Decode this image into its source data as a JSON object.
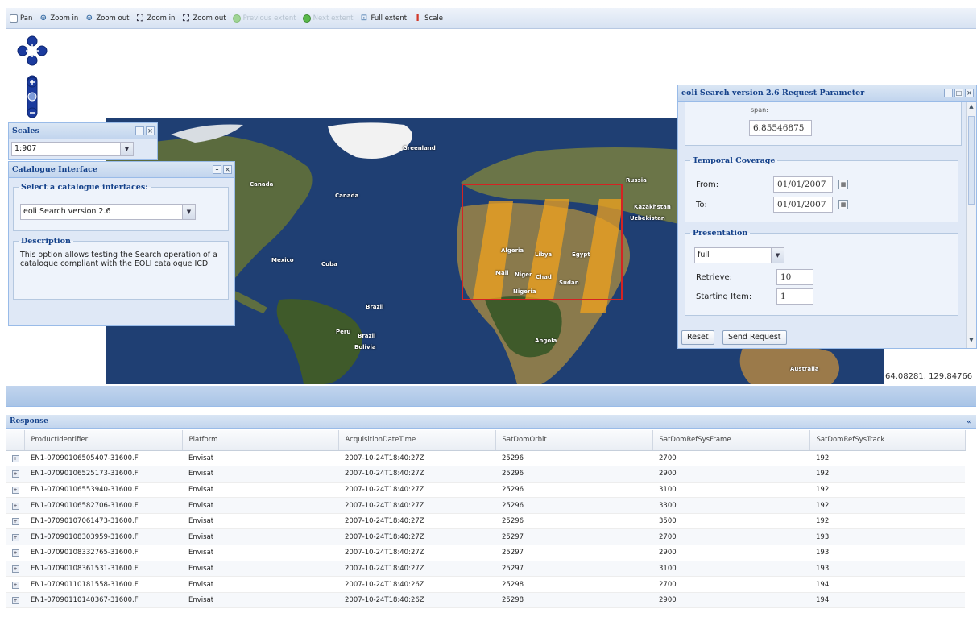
{
  "toolbar": {
    "pan": "Pan",
    "zoom_in": "Zoom in",
    "zoom_out": "Zoom out",
    "zoom_in_box": "Zoom in",
    "zoom_out_box": "Zoom out",
    "previous_extent": "Previous extent",
    "next_extent": "Next extent",
    "full_extent": "Full extent",
    "scale": "Scale"
  },
  "scales_panel": {
    "title": "Scales",
    "value": "1:907"
  },
  "catalogue_panel": {
    "title": "Catalogue Interface",
    "select_legend": "Select a catalogue interfaces:",
    "selected_interface": "eoli Search version 2.6",
    "description_legend": "Description",
    "description_text": "This option allows testing the Search operation of a catalogue compliant with the EOLI catalogue ICD"
  },
  "request_panel": {
    "title": "eoli Search version 2.6 Request Parameter",
    "spatial_label": "span:",
    "spatial_value": "6.85546875",
    "temporal_legend": "Temporal Coverage",
    "from_label": "From:",
    "from_value": "01/01/2007",
    "to_label": "To:",
    "to_value": "01/01/2007",
    "presentation_legend": "Presentation",
    "presentation_value": "full",
    "retrieve_label": "Retrieve:",
    "retrieve_value": "10",
    "starting_item_label": "Starting Item:",
    "starting_item_value": "1",
    "reset_button": "Reset",
    "send_button": "Send Request"
  },
  "map": {
    "coordinates": "64.08281, 129.84766",
    "labels": {
      "greenland": "Greenland",
      "canada": "Canada",
      "canada2": "Canada",
      "russia": "Russia",
      "kazakhstan": "Kazakhstan",
      "uzbekistan": "Uzbekistan",
      "mexico": "Mexico",
      "cuba": "Cuba",
      "algeria": "Algeria",
      "libya": "Libya",
      "egypt": "Egypt",
      "mali": "Mali",
      "niger": "Niger",
      "chad": "Chad",
      "sudan": "Sudan",
      "nigeria": "Nigeria",
      "brazil": "Brazil",
      "peru": "Peru",
      "brazil2": "Brazil",
      "bolivia": "Bolivia",
      "angola": "Angola",
      "australia": "Australia"
    },
    "colors": {
      "ocean": "#1f3f73",
      "land": "#5b6b3e",
      "ice": "#f2f2f2",
      "footprint": "#f0a31e",
      "selection": "#d42323"
    }
  },
  "response": {
    "title": "Response",
    "columns": [
      "ProductIdentifier",
      "Platform",
      "AcquisitionDateTime",
      "SatDomOrbit",
      "SatDomRefSysFrame",
      "SatDomRefSysTrack"
    ],
    "rows": [
      [
        "EN1-07090106505407-31600.F",
        "Envisat",
        "2007-10-24T18:40:27Z",
        "25296",
        "2700",
        "192"
      ],
      [
        "EN1-07090106525173-31600.F",
        "Envisat",
        "2007-10-24T18:40:27Z",
        "25296",
        "2900",
        "192"
      ],
      [
        "EN1-07090106553940-31600.F",
        "Envisat",
        "2007-10-24T18:40:27Z",
        "25296",
        "3100",
        "192"
      ],
      [
        "EN1-07090106582706-31600.F",
        "Envisat",
        "2007-10-24T18:40:27Z",
        "25296",
        "3300",
        "192"
      ],
      [
        "EN1-07090107061473-31600.F",
        "Envisat",
        "2007-10-24T18:40:27Z",
        "25296",
        "3500",
        "192"
      ],
      [
        "EN1-07090108303959-31600.F",
        "Envisat",
        "2007-10-24T18:40:27Z",
        "25297",
        "2700",
        "193"
      ],
      [
        "EN1-07090108332765-31600.F",
        "Envisat",
        "2007-10-24T18:40:27Z",
        "25297",
        "2900",
        "193"
      ],
      [
        "EN1-07090108361531-31600.F",
        "Envisat",
        "2007-10-24T18:40:27Z",
        "25297",
        "3100",
        "193"
      ],
      [
        "EN1-07090110181558-31600.F",
        "Envisat",
        "2007-10-24T18:40:26Z",
        "25298",
        "2700",
        "194"
      ],
      [
        "EN1-07090110140367-31600.F",
        "Envisat",
        "2007-10-24T18:40:26Z",
        "25298",
        "2900",
        "194"
      ]
    ]
  }
}
